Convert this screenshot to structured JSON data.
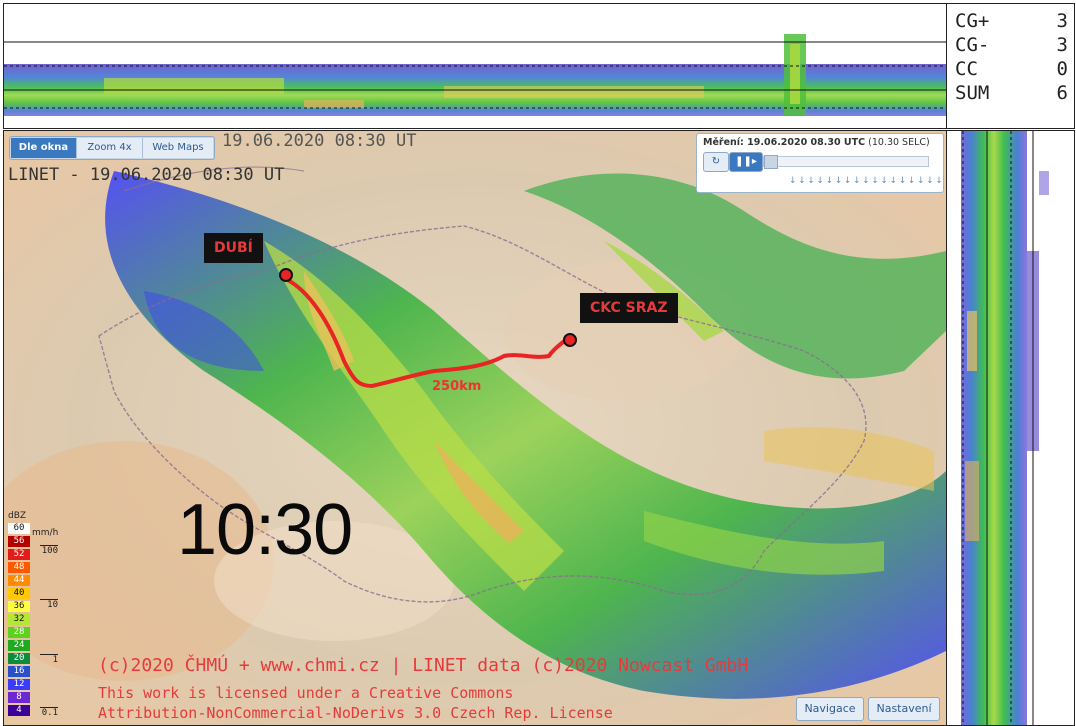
{
  "stats": [
    {
      "label": "CG+",
      "value": "3"
    },
    {
      "label": "CG-",
      "value": "3"
    },
    {
      "label": "CC",
      "value": "0"
    },
    {
      "label": "SUM",
      "value": "6"
    }
  ],
  "map_toolbar": {
    "fit_label": "Dle okna",
    "zoom_label": "Zoom 4x",
    "webmaps_label": "Web Maps"
  },
  "timestamp_ghost": "19.06.2020 08:30 UT",
  "linet_title": "LINET - 19.06.2020 08:30 UT",
  "player": {
    "label_prefix": "Měření: 19.06.2020 08.30 UTC",
    "label_suffix": "(10.30 SELC)",
    "refresh_icon": "refresh-icon",
    "play_icon": "pause-icon",
    "ticks": "↓↓↓↓↓↓↓↓↓↓↓↓↓↓↓↓↓↓↓↓↓↓↓↓↓"
  },
  "markers": {
    "start": "DUBÍ",
    "end": "CKC SRAZ",
    "distance": "250km"
  },
  "big_time": "10:30",
  "credits": {
    "line1": "(c)2020 ČHMÚ + www.chmi.cz | LINET data (c)2020 Nowcast GmbH",
    "line2": "This work is licensed under a Creative Commons",
    "line3": "Attribution-NonCommercial-NoDerivs 3.0 Czech Rep. License"
  },
  "map_buttons": {
    "navigation": "Navigace",
    "settings": "Nastavení"
  },
  "legend": {
    "unit_dbz": "dBZ",
    "unit_mmh": "mm/h",
    "dbz_levels": [
      "60",
      "56",
      "52",
      "48",
      "44",
      "40",
      "36",
      "32",
      "28",
      "24",
      "20",
      "16",
      "12",
      "8",
      "4"
    ],
    "colors": [
      "#ffffff",
      "#b50000",
      "#e21b1b",
      "#ff5a00",
      "#ff8c00",
      "#ffc800",
      "#ffff40",
      "#b4e632",
      "#5ad21e",
      "#1eaa1e",
      "#0c8c3c",
      "#2850c8",
      "#3c3cff",
      "#6e28d2",
      "#3c0096"
    ],
    "mmh_labels": [
      "100",
      "10",
      "1",
      "0.1"
    ]
  },
  "colors": {
    "route": "#e82424",
    "label_text": "#e63a3a",
    "accent": "#3a78c0"
  }
}
